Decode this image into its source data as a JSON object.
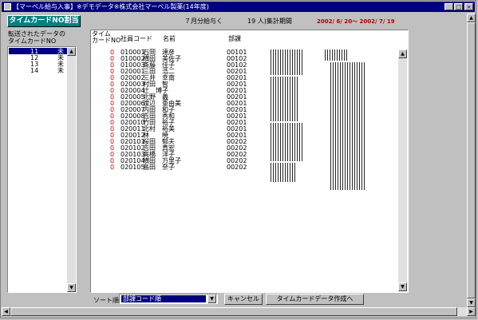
{
  "window": {
    "title": "【マーベル給与入事】※デモデータ※株式会社マーベル製薬(14年度)",
    "minimize": "_",
    "maximize": "□",
    "close": "×"
  },
  "toolbar": {
    "assign_button": "タイムカードNO割当",
    "month_label": "７月分給与く",
    "count_label": "19 人)集計期間",
    "period": "2002/ 6/ 20～ 2002/ 7/ 19"
  },
  "left_panel": {
    "heading_line1": "転送されたデータの",
    "heading_line2": "タイムカードNO",
    "items": [
      {
        "no": "11",
        "status": "未"
      },
      {
        "no": "12",
        "status": "未"
      },
      {
        "no": "13",
        "status": "未"
      },
      {
        "no": "14",
        "status": "未"
      }
    ]
  },
  "table": {
    "headers": {
      "timecard_line1": "タイム",
      "timecard_line2": "カードNO",
      "code": "社員コード",
      "name": "名前",
      "dept": "部課"
    },
    "rows": [
      {
        "tc": "0",
        "code": "010001",
        "name": "石岡　達彦",
        "dept": "00101"
      },
      {
        "tc": "0",
        "code": "010002",
        "name": "横田　美佐子",
        "dept": "00102"
      },
      {
        "tc": "0",
        "code": "010003",
        "name": "斎藤　佳子",
        "dept": "00102"
      },
      {
        "tc": "0",
        "code": "020001",
        "name": "三田　浩二",
        "dept": "00201"
      },
      {
        "tc": "0",
        "code": "020002",
        "name": "三井　幸南",
        "dept": "00201"
      },
      {
        "tc": "0",
        "code": "020003",
        "name": "村田　智",
        "dept": "00201"
      },
      {
        "tc": "0",
        "code": "020004",
        "name": "辻　博子",
        "dept": "00201"
      },
      {
        "tc": "0",
        "code": "020005",
        "name": "北野　義",
        "dept": "00201"
      },
      {
        "tc": "0",
        "code": "020006",
        "name": "渡辺　亜由美",
        "dept": "00201"
      },
      {
        "tc": "0",
        "code": "020007",
        "name": "内田　和子",
        "dept": "00201"
      },
      {
        "tc": "0",
        "code": "020008",
        "name": "吉田　秀和",
        "dept": "00201"
      },
      {
        "tc": "0",
        "code": "020010",
        "name": "竹田　裕子",
        "dept": "00201"
      },
      {
        "tc": "0",
        "code": "020011",
        "name": "北村　裕美",
        "dept": "00201"
      },
      {
        "tc": "0",
        "code": "020012",
        "name": "林　　暁",
        "dept": "00201"
      },
      {
        "tc": "0",
        "code": "020101",
        "name": "桜田　郁夫",
        "dept": "00202"
      },
      {
        "tc": "0",
        "code": "020102",
        "name": "吉田　真宏",
        "dept": "00202"
      },
      {
        "tc": "0",
        "code": "020103",
        "name": "高橋　洋子",
        "dept": "00202"
      },
      {
        "tc": "0",
        "code": "020104",
        "name": "横田　万里子",
        "dept": "00202"
      },
      {
        "tc": "0",
        "code": "020105",
        "name": "島田　奈子",
        "dept": "00202"
      }
    ]
  },
  "bottom": {
    "sort_label": "ソート順",
    "sort_value": "部課コード順",
    "cancel_button": "キャンセル",
    "create_button": "タイムカードデータ作成へ"
  }
}
